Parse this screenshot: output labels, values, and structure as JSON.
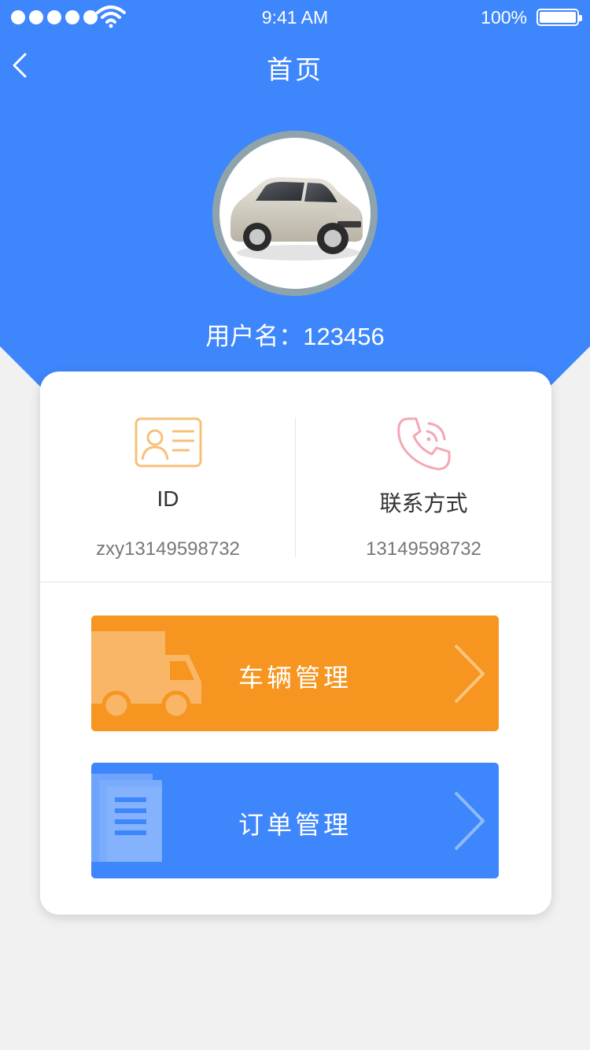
{
  "status_bar": {
    "time": "9:41 AM",
    "battery": "100%"
  },
  "nav": {
    "title": "首页"
  },
  "profile": {
    "username_label": "用户名：",
    "username": "123456"
  },
  "info": {
    "id": {
      "label": "ID",
      "value": "zxy13149598732"
    },
    "contact": {
      "label": "联系方式",
      "value": "13149598732"
    }
  },
  "actions": {
    "vehicle": {
      "label": "车辆管理"
    },
    "order": {
      "label": "订单管理"
    }
  },
  "colors": {
    "primary_blue": "#3e86fb",
    "accent_orange": "#f6951f",
    "background": "#f1f1f1"
  },
  "icons": [
    "signal-icon",
    "wifi-icon",
    "battery-icon",
    "back-arrow-icon",
    "id-card-icon",
    "phone-icon",
    "truck-icon",
    "document-icon",
    "chevron-right-icon"
  ]
}
